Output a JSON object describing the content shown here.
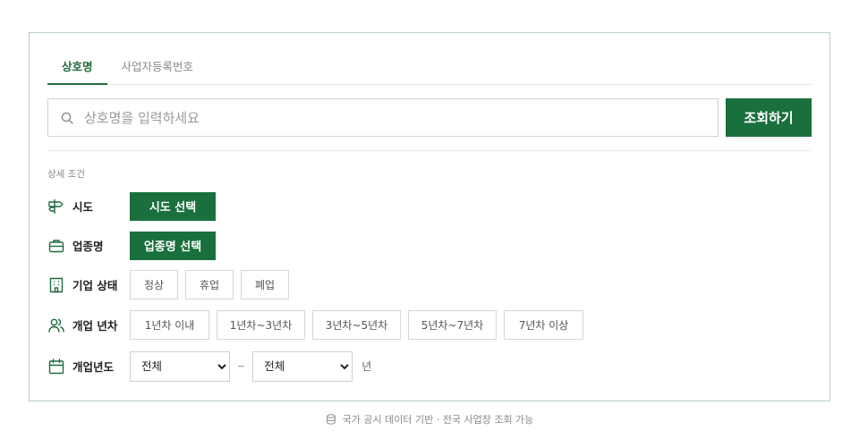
{
  "tabs": [
    {
      "label": "상호명",
      "active": true
    },
    {
      "label": "사업자등록번호",
      "active": false
    }
  ],
  "search": {
    "placeholder": "상호명을 입력하세요",
    "value": "",
    "button_label": "조회하기",
    "icon": "search-icon"
  },
  "filters": {
    "section_label": "상세 조건",
    "region": {
      "label": "시도",
      "icon": "signpost-icon",
      "button_label": "시도 선택"
    },
    "industry": {
      "label": "업종명",
      "icon": "briefcase-icon",
      "button_label": "업종명 선택"
    },
    "status": {
      "label": "기업 상태",
      "icon": "building-icon",
      "options": [
        "정상",
        "휴업",
        "폐업"
      ]
    },
    "years": {
      "label": "개업 년차",
      "icon": "users-icon",
      "options": [
        "1년차 이내",
        "1년차~3년차",
        "3년차~5년차",
        "5년차~7년차",
        "7년차 이상"
      ]
    },
    "year_range": {
      "label": "개업년도",
      "icon": "calendar-icon",
      "from": "전체",
      "to": "전체",
      "separator": "~",
      "unit": "년"
    }
  },
  "footer": {
    "text": "국가 공시 데이터 기반 · 전국 사업장 조회 가능",
    "icon": "database-icon"
  },
  "colors": {
    "accent": "#19703d",
    "border": "#b9d0c2"
  }
}
